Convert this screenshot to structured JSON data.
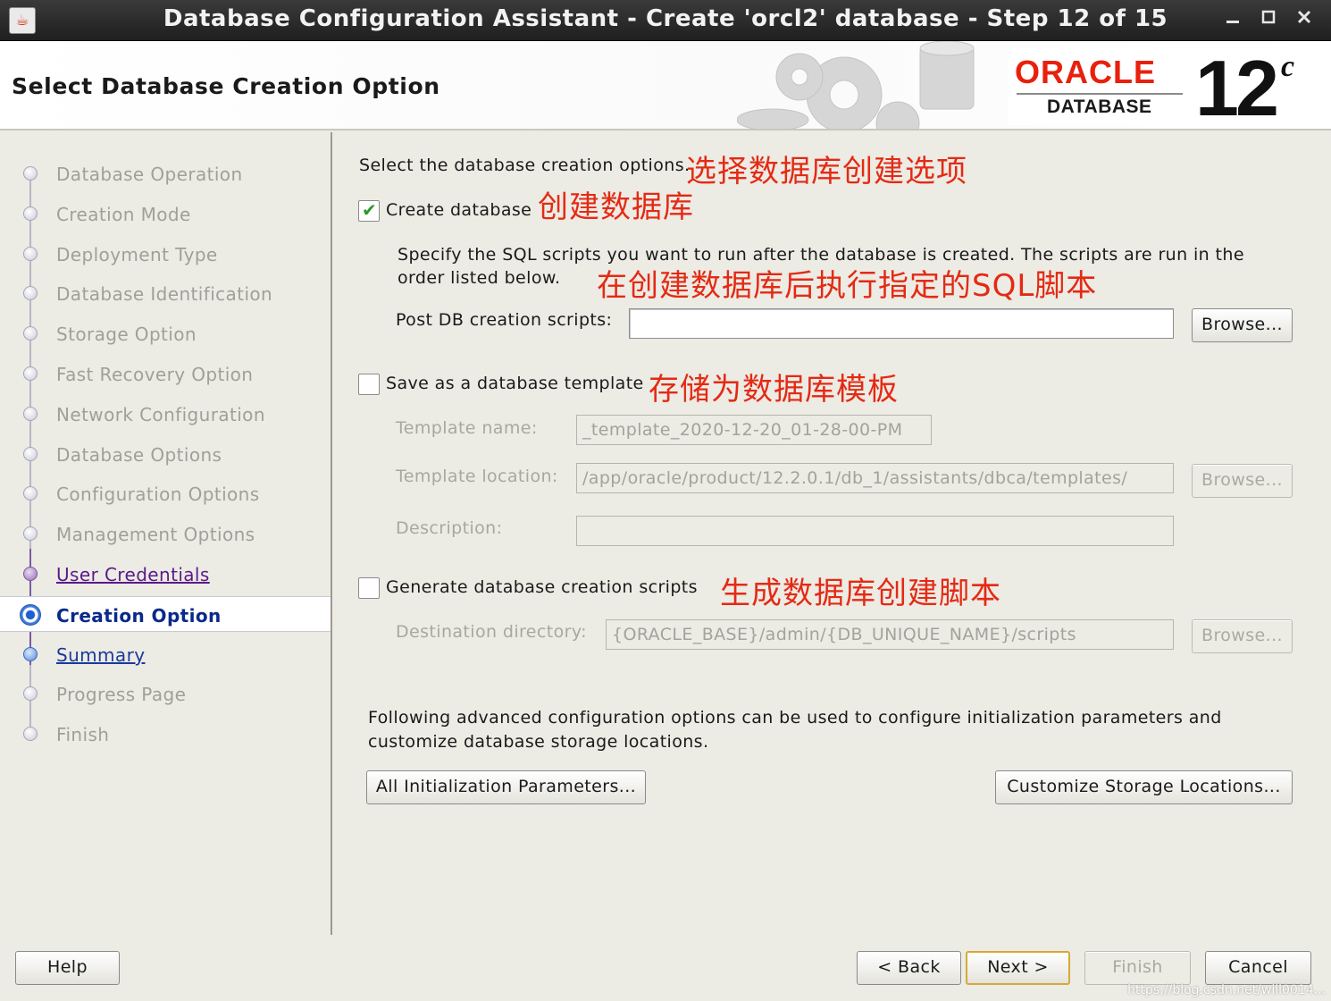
{
  "window": {
    "title": "Database Configuration Assistant - Create 'orcl2' database - Step 12 of 15",
    "app_icon": "java-icon",
    "controls": {
      "minimize": "‗",
      "maximize": "□",
      "close": "✕"
    }
  },
  "header": {
    "page_title": "Select Database Creation Option",
    "logo": {
      "brand": "ORACLE",
      "registered": "®",
      "product": "DATABASE",
      "version": "12",
      "version_suffix": "c"
    }
  },
  "nav": {
    "items": [
      {
        "label": "Database Operation",
        "state": "disabled"
      },
      {
        "label": "Creation Mode",
        "state": "disabled"
      },
      {
        "label": "Deployment Type",
        "state": "disabled"
      },
      {
        "label": "Database Identification",
        "state": "disabled"
      },
      {
        "label": "Storage Option",
        "state": "disabled"
      },
      {
        "label": "Fast Recovery Option",
        "state": "disabled"
      },
      {
        "label": "Network Configuration",
        "state": "disabled"
      },
      {
        "label": "Database Options",
        "state": "disabled"
      },
      {
        "label": "Configuration Options",
        "state": "disabled"
      },
      {
        "label": "Management Options",
        "state": "disabled"
      },
      {
        "label": "User Credentials",
        "state": "visited"
      },
      {
        "label": "Creation Option",
        "state": "current"
      },
      {
        "label": "Summary",
        "state": "link"
      },
      {
        "label": "Progress Page",
        "state": "disabled"
      },
      {
        "label": "Finish",
        "state": "disabled"
      }
    ]
  },
  "main": {
    "intro": "Select the database creation options.",
    "annotations": {
      "intro_zh": "选择数据库创建选项",
      "create_zh": "创建数据库",
      "scripts_zh": "在创建数据库后执行指定的SQL脚本",
      "template_zh": "存储为数据库模板",
      "generate_zh": "生成数据库创建脚本"
    },
    "create_database": {
      "label": "Create database",
      "checked": true,
      "desc_line1": "Specify the SQL scripts you want to run after the database is created. The scripts are run in the",
      "desc_line2": "order listed below.",
      "post_scripts_label": "Post DB creation scripts:",
      "post_scripts_value": "",
      "browse": "Browse..."
    },
    "save_template": {
      "label": "Save as a database template",
      "checked": false,
      "name_label": "Template name:",
      "name_value": "_template_2020-12-20_01-28-00-PM",
      "location_label": "Template location:",
      "location_value": "/app/oracle/product/12.2.0.1/db_1/assistants/dbca/templates/",
      "browse": "Browse...",
      "description_label": "Description:",
      "description_value": ""
    },
    "generate_scripts": {
      "label": "Generate database creation scripts",
      "checked": false,
      "dest_label": "Destination directory:",
      "dest_value": "{ORACLE_BASE}/admin/{DB_UNIQUE_NAME}/scripts",
      "browse": "Browse..."
    },
    "advanced": {
      "text_line1": "Following advanced configuration options can be used to configure initialization parameters and",
      "text_line2": "customize database storage locations.",
      "init_params_button": "All Initialization Parameters...",
      "storage_button": "Customize Storage Locations..."
    }
  },
  "footer": {
    "help": "Help",
    "back": "< Back",
    "next": "Next >",
    "finish": "Finish",
    "cancel": "Cancel"
  },
  "watermark": "https://blog.csdn.net/will0014..."
}
